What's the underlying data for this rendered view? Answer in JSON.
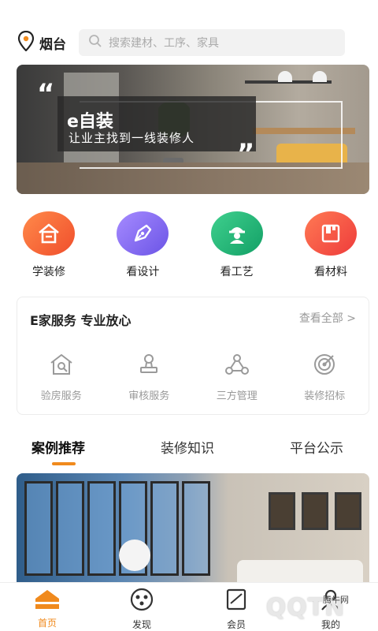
{
  "topbar": {
    "location": "烟台",
    "search_placeholder": "搜索建材、工序、家具"
  },
  "banner": {
    "title": "e自装",
    "subtitle": "让业主找到一线装修人"
  },
  "categories": [
    {
      "label": "学装修",
      "color": "#f46a3a",
      "icon": "house-icon"
    },
    {
      "label": "看设计",
      "color": "#8a6cf0",
      "icon": "pen-nib-icon"
    },
    {
      "label": "看工艺",
      "color": "#23b37a",
      "icon": "worker-icon"
    },
    {
      "label": "看材料",
      "color": "#f6513f",
      "icon": "box-icon"
    }
  ],
  "service": {
    "title": "E家服务 专业放心",
    "more": "查看全部 >",
    "items": [
      {
        "label": "验房服务",
        "icon": "house-search-icon"
      },
      {
        "label": "审核服务",
        "icon": "stamp-icon"
      },
      {
        "label": "三方管理",
        "icon": "network-icon"
      },
      {
        "label": "装修招标",
        "icon": "target-icon"
      }
    ]
  },
  "tabs": [
    "案例推荐",
    "装修知识",
    "平台公示"
  ],
  "bottom_nav": [
    {
      "label": "首页",
      "icon": "home-icon",
      "active": true
    },
    {
      "label": "发现",
      "icon": "discover-icon",
      "active": false
    },
    {
      "label": "会员",
      "icon": "member-icon",
      "active": false
    },
    {
      "label": "我的",
      "icon": "profile-icon",
      "active": false
    }
  ],
  "watermark": {
    "brand": "QQTN",
    "site": "腾牛网"
  },
  "colors": {
    "accent": "#f08a1d"
  }
}
